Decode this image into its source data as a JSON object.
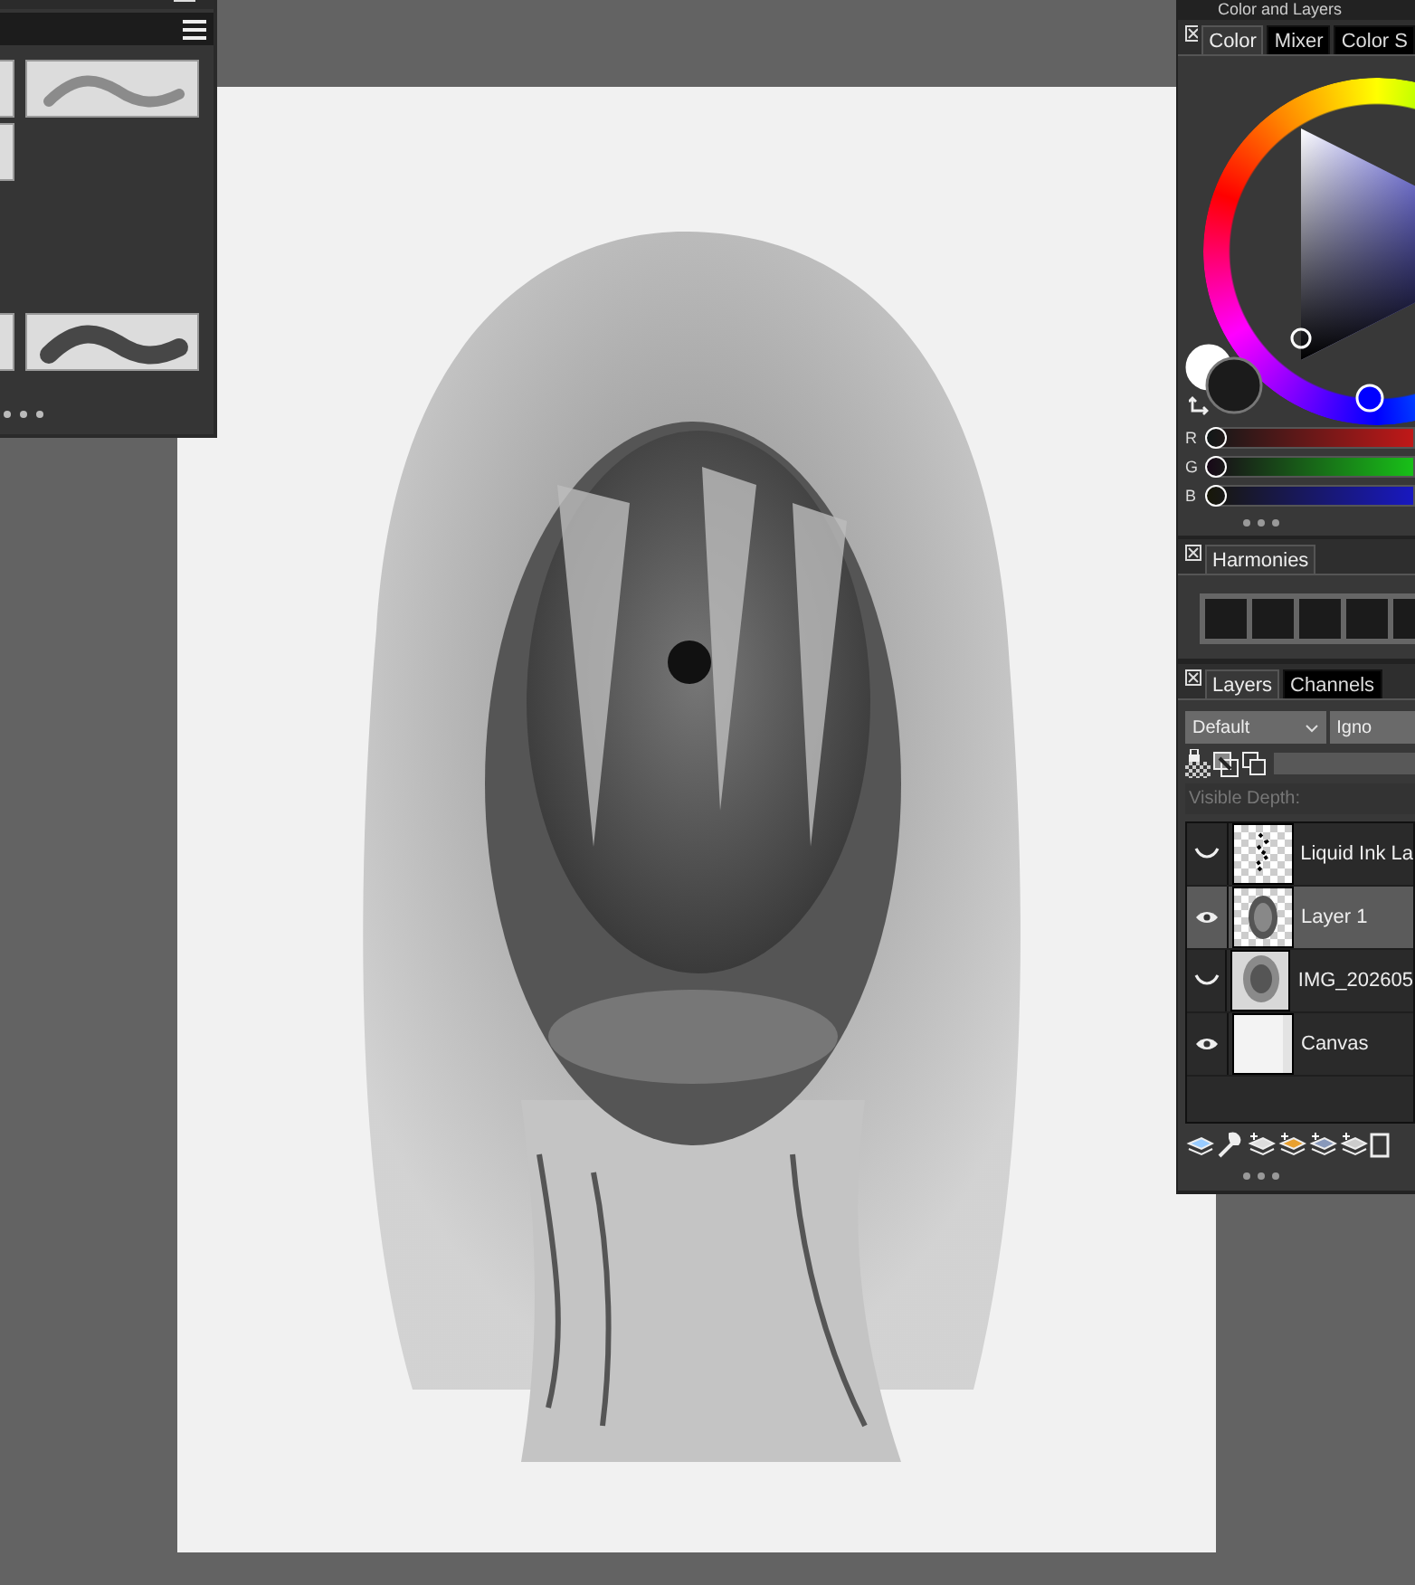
{
  "color_and_layers": {
    "title": "Color and Layers",
    "color_tabs": [
      {
        "label": "Color",
        "selected": true
      },
      {
        "label": "Mixer",
        "selected": false
      },
      {
        "label": "Color S",
        "selected": false
      }
    ],
    "rgb_sliders": [
      {
        "label": "R",
        "level": 0.04
      },
      {
        "label": "G",
        "level": 0.04
      },
      {
        "label": "B",
        "level": 0.04
      }
    ],
    "harmonies_tab": {
      "label": "Harmonies"
    },
    "layer_tabs": [
      {
        "label": "Layers",
        "selected": true
      },
      {
        "label": "Channels",
        "selected": false
      }
    ],
    "composite_method": {
      "value": "Default"
    },
    "composite_depth": {
      "value": "Igno"
    },
    "opacity_slider": {
      "level": 1
    },
    "visible_depth": {
      "label": "Visible Depth:",
      "disabled": true
    },
    "layers": [
      {
        "name": "Liquid Ink La",
        "visible": false,
        "selected": false,
        "kind": "ink"
      },
      {
        "name": "Layer 1",
        "visible": true,
        "selected": true,
        "kind": "paint"
      },
      {
        "name": "IMG_202605",
        "visible": false,
        "selected": false
      },
      {
        "name": "Canvas",
        "visible": true,
        "selected": false,
        "kind": "blank"
      }
    ]
  }
}
